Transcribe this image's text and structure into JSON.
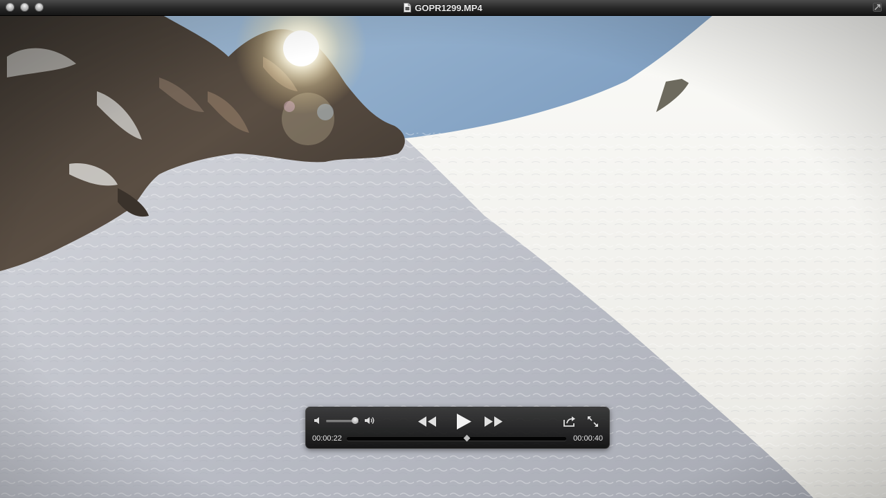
{
  "window": {
    "title": "GOPR1299.MP4"
  },
  "player": {
    "elapsed": "00:00:22",
    "duration": "00:00:40",
    "playback_position": 0.55,
    "volume_level": 0.88,
    "state": "paused"
  },
  "icons": {
    "title_document": "document-icon",
    "volume_low": "speaker-low-icon",
    "volume_high": "speaker-high-icon",
    "rewind": "rewind-icon",
    "play": "play-icon",
    "fast_forward": "fast-forward-icon",
    "share": "share-icon",
    "fullscreen": "fullscreen-icon"
  },
  "colors": {
    "sky": "#7f9fbf",
    "snow": "#efefef",
    "snow_shadow": "#b9bcc4",
    "rock": "#4a4037",
    "hud_background": "#1c1c1c"
  }
}
